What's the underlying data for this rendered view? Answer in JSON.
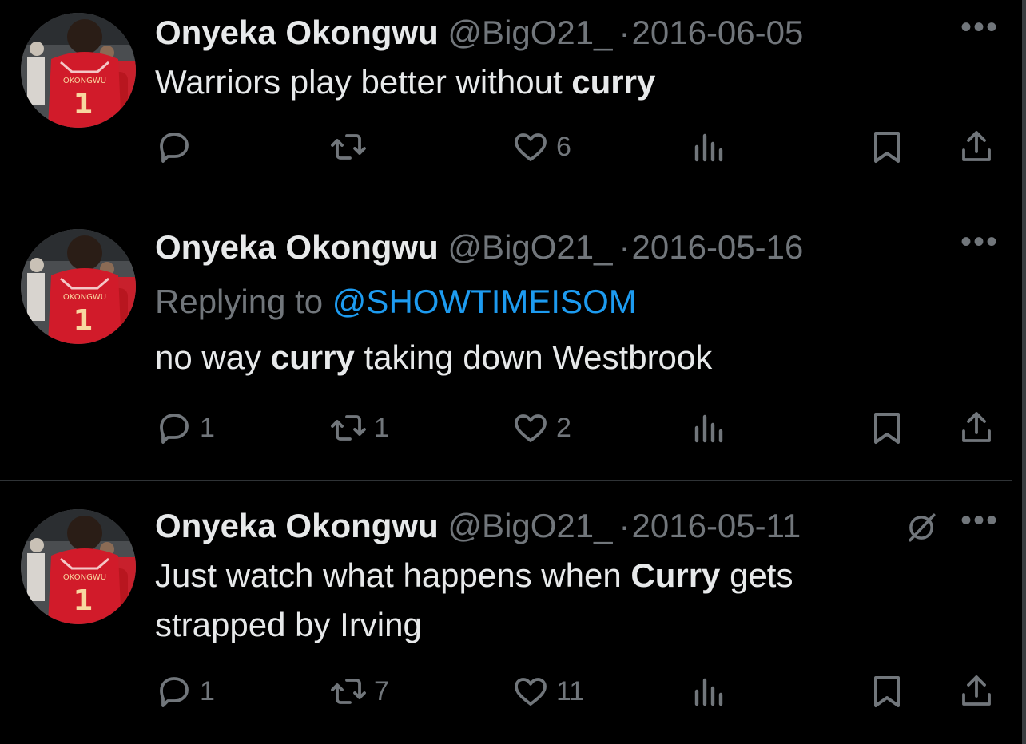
{
  "tweets": [
    {
      "name": "Onyeka Okongwu",
      "handle": "@BigO21_",
      "separator": "·",
      "date": "2016-06-05",
      "replying_label": "",
      "replying_mention": "",
      "text_before": "Warriors play better without ",
      "text_bold": "curry",
      "text_after": "",
      "replies": "",
      "retweets": "",
      "likes": "6",
      "muted_icon": false
    },
    {
      "name": "Onyeka Okongwu",
      "handle": "@BigO21_",
      "separator": "·",
      "date": "2016-05-16",
      "replying_label": "Replying to ",
      "replying_mention": "@SHOWTIMEISOM",
      "text_before": "no way ",
      "text_bold": "curry",
      "text_after": " taking down Westbrook",
      "replies": "1",
      "retweets": "1",
      "likes": "2",
      "muted_icon": false
    },
    {
      "name": "Onyeka Okongwu",
      "handle": "@BigO21_",
      "separator": "·",
      "date": "2016-05-11",
      "replying_label": "",
      "replying_mention": "",
      "text_before": "Just watch what happens when ",
      "text_bold": "Curry",
      "text_after": " gets strapped by Irving",
      "replies": "1",
      "retweets": "7",
      "likes": "11",
      "muted_icon": true
    }
  ],
  "more_label": "•••",
  "jersey_number": "1",
  "jersey_name": "OKONGWU",
  "colors": {
    "background": "#000000",
    "primary_text": "#e7e9ea",
    "secondary_text": "#71767b",
    "link": "#1d9bf0",
    "divider": "#2f3336",
    "jersey": "#d11b2a"
  },
  "icons": [
    "reply-icon",
    "retweet-icon",
    "like-icon",
    "views-icon",
    "bookmark-icon",
    "share-icon",
    "more-icon",
    "muted-icon",
    "avatar"
  ]
}
